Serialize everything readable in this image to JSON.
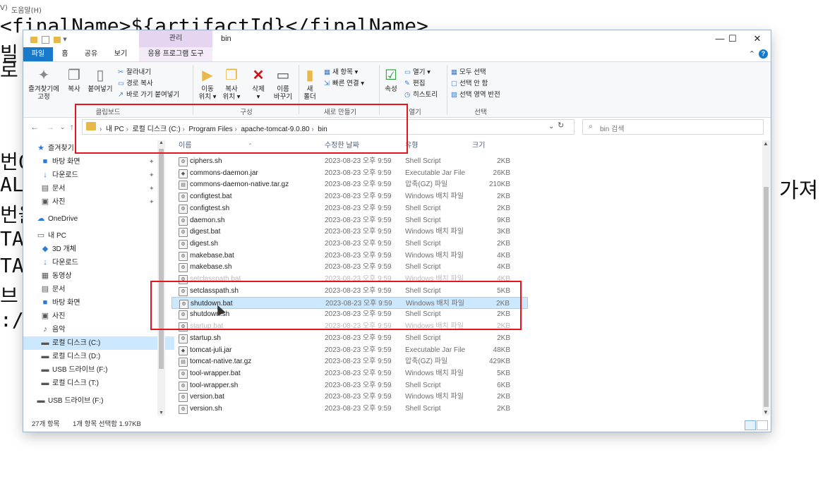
{
  "background": {
    "menubar": [
      "V)",
      "도움말(H)"
    ],
    "code_line": "<finalName>${artifactId}</finalName>",
    "left_fragments": [
      "빌",
      "로",
      "번C",
      "AL",
      "번을",
      "TA",
      "TA",
      "브",
      ":/"
    ],
    "right_fragment": "가져"
  },
  "window": {
    "title": "bin",
    "context_tab_label": "관리",
    "qat": "▾",
    "controls": {
      "minimize": "—",
      "maximize": "☐",
      "close": "✕"
    }
  },
  "tabs": [
    "파일",
    "홈",
    "공유",
    "보기",
    "응용 프로그램 도구"
  ],
  "ribbon": {
    "clipboard": {
      "pin_label_1": "즐겨찾기에",
      "pin_label_2": "고정",
      "copy": "복사",
      "paste": "붙여넣기",
      "cut": "잘라내기",
      "copy_path": "경로 복사",
      "paste_shortcut": "바로 가기 붙여넣기",
      "group": "클립보드"
    },
    "organize": {
      "move_1": "이동",
      "move_2": "위치 ▾",
      "copy_1": "복사",
      "copy_2": "위치 ▾",
      "delete_1": "삭제",
      "delete_2": "▾",
      "rename_1": "이름",
      "rename_2": "바꾸기",
      "group": "구성"
    },
    "new": {
      "folder_1": "새",
      "folder_2": "폴더",
      "new_item": "새 항목 ▾",
      "easy_access": "빠른 연결 ▾",
      "group": "새로 만들기"
    },
    "open": {
      "properties": "속성",
      "open": "열기 ▾",
      "edit": "편집",
      "history": "히스토리",
      "group": "열기"
    },
    "select": {
      "select_all": "모두 선택",
      "select_none": "선택 안 함",
      "invert": "선택 영역 반전",
      "group": "선택"
    }
  },
  "address": {
    "crumbs": [
      "내 PC",
      "로컬 디스크 (C:)",
      "Program Files",
      "apache-tomcat-9.0.80",
      "bin"
    ],
    "search_placeholder": "bin 검색"
  },
  "nav": [
    {
      "icon": "★",
      "label": "즐겨찾기",
      "pin": false
    },
    {
      "icon": "■",
      "label": "바탕 화면",
      "pin": true
    },
    {
      "icon": "↓",
      "label": "다운로드",
      "pin": true
    },
    {
      "icon": "▤",
      "label": "문서",
      "pin": true
    },
    {
      "icon": "▣",
      "label": "사진",
      "pin": true
    },
    {
      "icon": "☁",
      "label": "OneDrive",
      "pin": false
    },
    {
      "icon": "▭",
      "label": "내 PC",
      "pin": false
    },
    {
      "icon": "◆",
      "label": "3D 개체",
      "pin": false
    },
    {
      "icon": "↓",
      "label": "다운로드",
      "pin": false
    },
    {
      "icon": "▦",
      "label": "동영상",
      "pin": false
    },
    {
      "icon": "▤",
      "label": "문서",
      "pin": false
    },
    {
      "icon": "■",
      "label": "바탕 화면",
      "pin": false
    },
    {
      "icon": "▣",
      "label": "사진",
      "pin": false
    },
    {
      "icon": "♪",
      "label": "음악",
      "pin": false
    },
    {
      "icon": "▬",
      "label": "로컬 디스크 (C:)",
      "pin": false
    },
    {
      "icon": "▬",
      "label": "로컬 디스크 (D:)",
      "pin": false
    },
    {
      "icon": "▬",
      "label": "USB 드라이브 (F:)",
      "pin": false
    },
    {
      "icon": "▬",
      "label": "로컬 디스크 (T:)",
      "pin": false
    },
    {
      "icon": "▬",
      "label": "USB 드라이브 (F:)",
      "pin": false
    }
  ],
  "columns": {
    "name": "이름",
    "date": "수정한 날짜",
    "type": "유형",
    "size": "크기"
  },
  "files": [
    {
      "name": "ciphers.sh",
      "date": "2023-08-23 오후 9:59",
      "type": "Shell Script",
      "size": "2KB"
    },
    {
      "name": "commons-daemon.jar",
      "date": "2023-08-23 오후 9:59",
      "type": "Executable Jar File",
      "size": "26KB"
    },
    {
      "name": "commons-daemon-native.tar.gz",
      "date": "2023-08-23 오후 9:59",
      "type": "압축(GZ) 파일",
      "size": "210KB"
    },
    {
      "name": "configtest.bat",
      "date": "2023-08-23 오후 9:59",
      "type": "Windows 배치 파일",
      "size": "2KB"
    },
    {
      "name": "configtest.sh",
      "date": "2023-08-23 오후 9:59",
      "type": "Shell Script",
      "size": "2KB"
    },
    {
      "name": "daemon.sh",
      "date": "2023-08-23 오후 9:59",
      "type": "Shell Script",
      "size": "9KB"
    },
    {
      "name": "digest.bat",
      "date": "2023-08-23 오후 9:59",
      "type": "Windows 배치 파일",
      "size": "3KB"
    },
    {
      "name": "digest.sh",
      "date": "2023-08-23 오후 9:59",
      "type": "Shell Script",
      "size": "2KB"
    },
    {
      "name": "makebase.bat",
      "date": "2023-08-23 오후 9:59",
      "type": "Windows 배치 파일",
      "size": "4KB"
    },
    {
      "name": "makebase.sh",
      "date": "2023-08-23 오후 9:59",
      "type": "Shell Script",
      "size": "4KB"
    },
    {
      "name": "setclasspath.bat",
      "date": "2023-08-23 오후 9:59",
      "type": "Windows 배치 파일",
      "size": "4KB"
    },
    {
      "name": "setclasspath.sh",
      "date": "2023-08-23 오후 9:59",
      "type": "Shell Script",
      "size": "5KB"
    },
    {
      "name": "shutdown.bat",
      "date": "2023-08-23 오후 9:59",
      "type": "Windows 배치 파일",
      "size": "2KB"
    },
    {
      "name": "shutdown.sh",
      "date": "2023-08-23 오후 9:59",
      "type": "Shell Script",
      "size": "2KB"
    },
    {
      "name": "startup.bat",
      "date": "2023-08-23 오후 9:59",
      "type": "Windows 배치 파일",
      "size": "2KB"
    },
    {
      "name": "startup.sh",
      "date": "2023-08-23 오후 9:59",
      "type": "Shell Script",
      "size": "2KB"
    },
    {
      "name": "tomcat-juli.jar",
      "date": "2023-08-23 오후 9:59",
      "type": "Executable Jar File",
      "size": "48KB"
    },
    {
      "name": "tomcat-native.tar.gz",
      "date": "2023-08-23 오후 9:59",
      "type": "압축(GZ) 파일",
      "size": "429KB"
    },
    {
      "name": "tool-wrapper.bat",
      "date": "2023-08-23 오후 9:59",
      "type": "Windows 배치 파일",
      "size": "5KB"
    },
    {
      "name": "tool-wrapper.sh",
      "date": "2023-08-23 오후 9:59",
      "type": "Shell Script",
      "size": "6KB"
    },
    {
      "name": "version.bat",
      "date": "2023-08-23 오후 9:59",
      "type": "Windows 배치 파일",
      "size": "2KB"
    },
    {
      "name": "version.sh",
      "date": "2023-08-23 오후 9:59",
      "type": "Shell Script",
      "size": "2KB"
    }
  ],
  "selected_file": "shutdown.bat",
  "status": {
    "count": "27개 항목",
    "selection": "1개 항목 선택함 1.97KB"
  },
  "colors": {
    "accent": "#1979ca",
    "annotation": "#e8141c",
    "selection": "#cce8ff"
  }
}
